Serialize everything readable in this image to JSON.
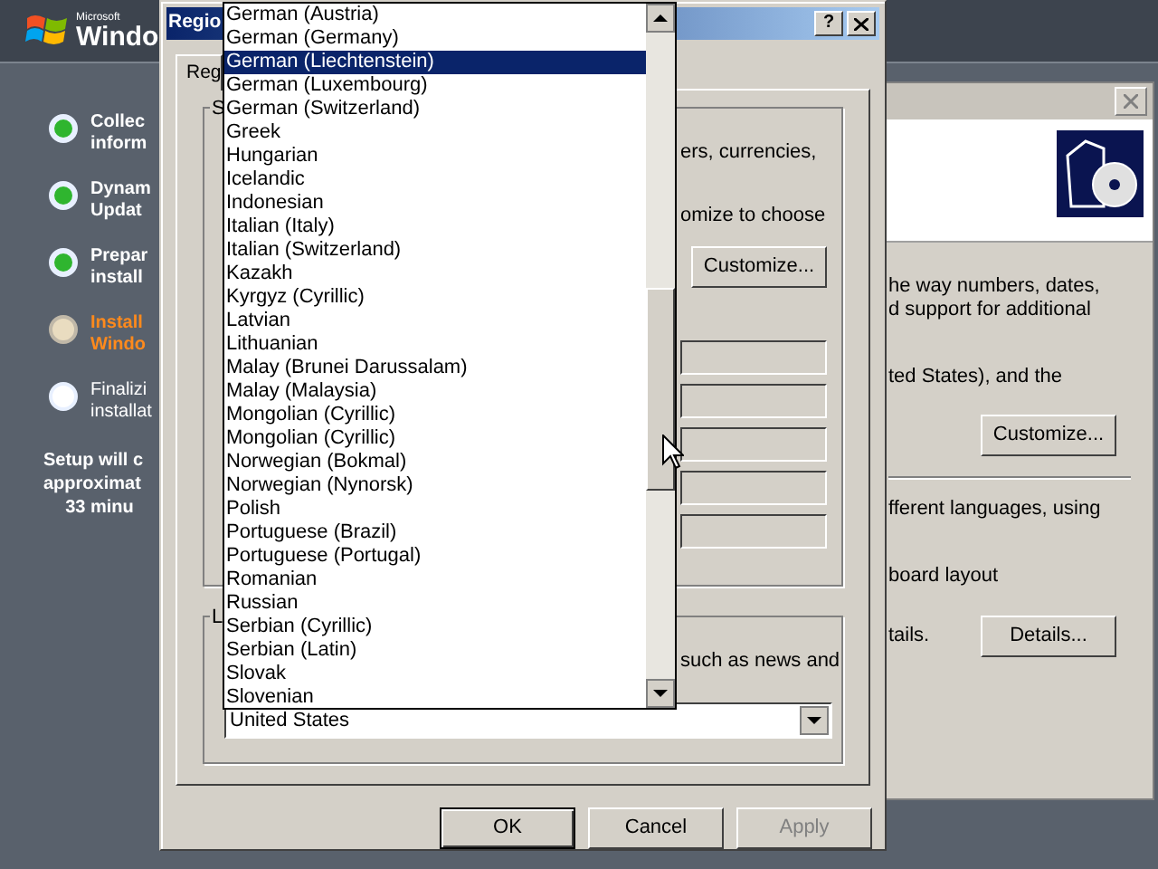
{
  "desktop": {
    "logo": {
      "small": "Microsoft",
      "text": "Windo"
    },
    "steps": [
      {
        "lines": [
          "Collec",
          "inform"
        ],
        "kind": "done"
      },
      {
        "lines": [
          "Dynam",
          "Updat"
        ],
        "kind": "done"
      },
      {
        "lines": [
          "Prepar",
          "install"
        ],
        "kind": "done"
      },
      {
        "lines": [
          "Install",
          "Windo"
        ],
        "kind": "current"
      },
      {
        "lines": [
          "Finalizi",
          "installat"
        ],
        "kind": "pending"
      }
    ],
    "time_estimate": [
      "Setup will c",
      "approximat",
      "33 minu"
    ]
  },
  "back_window": {
    "text_1": [
      "he way numbers, dates,",
      "d support for additional"
    ],
    "text_2": "ted States), and the",
    "button_1": "Customize...",
    "text_3": "fferent languages, using",
    "text_4": "board layout",
    "text_5": "tails.",
    "button_2": "Details..."
  },
  "dialog": {
    "title": "Regio",
    "help_button": "?",
    "tab": {
      "label": "Reg",
      "selected": true
    },
    "group_1": {
      "label": "S",
      "text_1": "ers, currencies,",
      "text_2": "omize to choose",
      "button": "Customize..."
    },
    "group_2": {
      "label": "L",
      "text": "such as news and",
      "combo_value": "United States"
    },
    "dropdown": {
      "items": [
        {
          "label": "German (Austria)",
          "selected": false
        },
        {
          "label": "German (Germany)",
          "selected": false
        },
        {
          "label": "German (Liechtenstein)",
          "selected": true
        },
        {
          "label": "German (Luxembourg)",
          "selected": false
        },
        {
          "label": "German (Switzerland)",
          "selected": false
        },
        {
          "label": "Greek",
          "selected": false
        },
        {
          "label": "Hungarian",
          "selected": false
        },
        {
          "label": "Icelandic",
          "selected": false
        },
        {
          "label": "Indonesian",
          "selected": false
        },
        {
          "label": "Italian (Italy)",
          "selected": false
        },
        {
          "label": "Italian (Switzerland)",
          "selected": false
        },
        {
          "label": "Kazakh",
          "selected": false
        },
        {
          "label": "Kyrgyz (Cyrillic)",
          "selected": false
        },
        {
          "label": "Latvian",
          "selected": false
        },
        {
          "label": "Lithuanian",
          "selected": false
        },
        {
          "label": "Malay (Brunei Darussalam)",
          "selected": false
        },
        {
          "label": "Malay (Malaysia)",
          "selected": false
        },
        {
          "label": "Mongolian (Cyrillic)",
          "selected": false
        },
        {
          "label": "Mongolian (Cyrillic)",
          "selected": false
        },
        {
          "label": "Norwegian (Bokmal)",
          "selected": false
        },
        {
          "label": "Norwegian (Nynorsk)",
          "selected": false
        },
        {
          "label": "Polish",
          "selected": false
        },
        {
          "label": "Portuguese (Brazil)",
          "selected": false
        },
        {
          "label": "Portuguese (Portugal)",
          "selected": false
        },
        {
          "label": "Romanian",
          "selected": false
        },
        {
          "label": "Russian",
          "selected": false
        },
        {
          "label": "Serbian (Cyrillic)",
          "selected": false
        },
        {
          "label": "Serbian (Latin)",
          "selected": false
        },
        {
          "label": "Slovak",
          "selected": false
        },
        {
          "label": "Slovenian",
          "selected": false
        }
      ]
    },
    "buttons": [
      {
        "label": "OK",
        "default": true,
        "disabled": false
      },
      {
        "label": "Cancel",
        "default": false,
        "disabled": false
      },
      {
        "label": "Apply",
        "default": false,
        "disabled": true
      }
    ]
  }
}
